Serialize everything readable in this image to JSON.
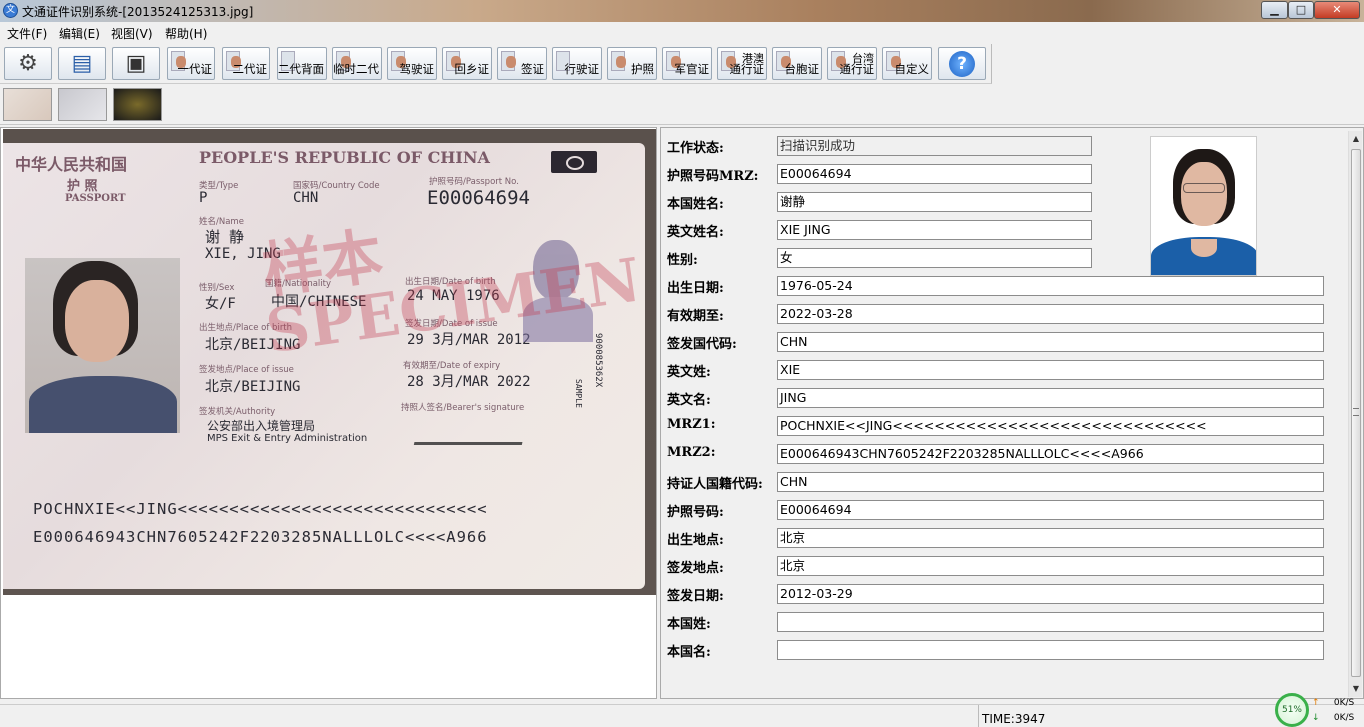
{
  "window": {
    "title": "文通证件识别系统-[2013524125313.jpg]",
    "min_label": "▁",
    "max_label": "□",
    "close_label": "✕"
  },
  "menu": [
    "文件(F)",
    "编辑(E)",
    "视图(V)",
    "帮助(H)"
  ],
  "toolbar": {
    "items": [
      {
        "label": "",
        "icon": "gear-icon"
      },
      {
        "label": "",
        "icon": "scanner-icon"
      },
      {
        "label": "",
        "icon": "card-reader-icon"
      },
      {
        "label": "一代证"
      },
      {
        "label": "二代证"
      },
      {
        "label": "二代背面"
      },
      {
        "label": "临时二代"
      },
      {
        "label": "驾驶证"
      },
      {
        "label": "回乡证"
      },
      {
        "label": "签证"
      },
      {
        "label": "行驶证"
      },
      {
        "label": "护照"
      },
      {
        "label": "军官证"
      },
      {
        "label": "港澳",
        "label2": "通行证"
      },
      {
        "label": "台胞证"
      },
      {
        "label": "台湾",
        "label2": "通行证"
      },
      {
        "label": "自定义"
      },
      {
        "label": "?",
        "icon": "help-icon"
      }
    ]
  },
  "passport_scan": {
    "header_cn": "中华人民共和国",
    "header_en": "PEOPLE'S REPUBLIC OF CHINA",
    "passport_cn": "护  照",
    "passport_en": "PASSPORT",
    "type_label": "类型/Type",
    "type": "P",
    "country_label": "国家码/Country Code",
    "country": "CHN",
    "passport_no_label": "护照号码/Passport No.",
    "passport_no": "E00064694",
    "name_label": "姓名/Name",
    "name_cn": "谢 静",
    "name_en": "XIE, JING",
    "sex_label": "性别/Sex",
    "sex": "女/F",
    "nationality_label": "国籍/Nationality",
    "nationality": "中国/CHINESE",
    "dob_label": "出生日期/Date of birth",
    "dob": "24 MAY 1976",
    "pob_label": "出生地点/Place of birth",
    "pob": "北京/BEIJING",
    "doi_label": "签发日期/Date of issue",
    "doi": "29 3月/MAR 2012",
    "poi_label": "签发地点/Place of issue",
    "poi": "北京/BEIJING",
    "doe_label": "有效期至/Date of expiry",
    "doe": "28 3月/MAR 2022",
    "authority_label": "签发机关/Authority",
    "authority_cn": "公安部出入境管理局",
    "authority_en": "MPS Exit & Entry Administration",
    "signature_label": "持照人签名/Bearer's signature",
    "serial": "900085362X",
    "sample": "SAMPLE",
    "watermark": "样本SPECIMEN",
    "mrz1": "POCHNXIE<<JING<<<<<<<<<<<<<<<<<<<<<<<<<<<<<<",
    "mrz2": "E000646943CHN7605242F2203285NALLLOLC<<<<A966"
  },
  "fields": [
    {
      "label": "工作状态:",
      "value": "扫描识别成功"
    },
    {
      "label": "护照号码MRZ:",
      "value": "E00064694"
    },
    {
      "label": "本国姓名:",
      "value": "谢静"
    },
    {
      "label": "英文姓名:",
      "value": "XIE  JING"
    },
    {
      "label": "性别:",
      "value": "女"
    },
    {
      "label": "出生日期:",
      "value": "1976-05-24"
    },
    {
      "label": "有效期至:",
      "value": "2022-03-28"
    },
    {
      "label": "签发国代码:",
      "value": "CHN"
    },
    {
      "label": "英文姓:",
      "value": "XIE"
    },
    {
      "label": "英文名:",
      "value": "JING"
    },
    {
      "label": "MRZ1:",
      "value": "POCHNXIE<<JING<<<<<<<<<<<<<<<<<<<<<<<<<<<<<<"
    },
    {
      "label": "MRZ2:",
      "value": "E000646943CHN7605242F2203285NALLLOLC<<<<A966"
    },
    {
      "label": "持证人国籍代码:",
      "value": "CHN"
    },
    {
      "label": "护照号码:",
      "value": "E00064694"
    },
    {
      "label": "出生地点:",
      "value": "北京"
    },
    {
      "label": "签发地点:",
      "value": "北京"
    },
    {
      "label": "签发日期:",
      "value": "2012-03-29"
    },
    {
      "label": "本国姓:",
      "value": ""
    },
    {
      "label": "本国名:",
      "value": ""
    }
  ],
  "status": {
    "time": "TIME:3947",
    "net_percent": "51%",
    "upload": "0K/S",
    "download": "0K/S"
  }
}
